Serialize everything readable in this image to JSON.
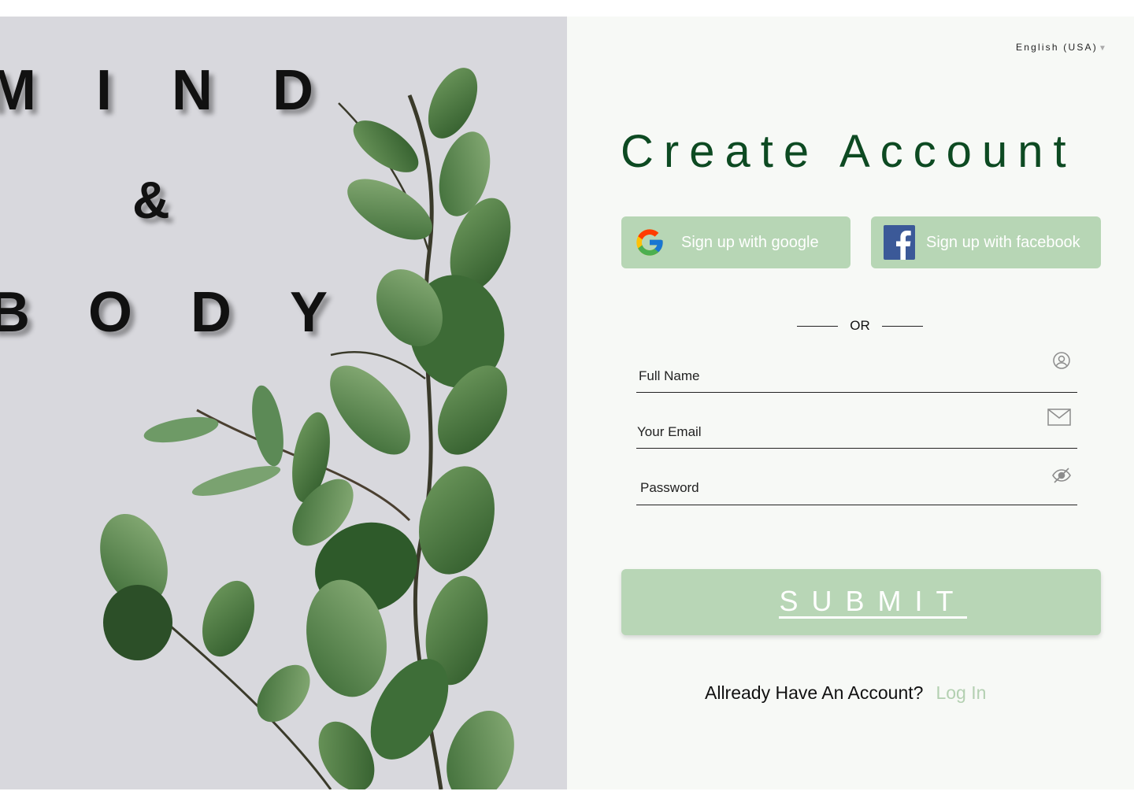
{
  "hero": {
    "word_mind": "MIND",
    "word_amp": "&",
    "word_body": "BODY"
  },
  "language_selector": {
    "label": "English (USA)",
    "caret_icon": "caret-down-icon"
  },
  "form": {
    "title": "Create Account",
    "google_button_label": "Sign up with google",
    "facebook_button_label": "Sign up with facebook",
    "divider_text": "OR",
    "fields": {
      "full_name": {
        "placeholder": "Full Name",
        "value": "",
        "icon": "user-circle-icon"
      },
      "email": {
        "placeholder": "Your Email",
        "value": "",
        "icon": "envelope-icon"
      },
      "password": {
        "placeholder": "Password",
        "value": "",
        "icon": "eye-slash-icon"
      }
    },
    "submit_label": "SUBMIT",
    "login_prompt": "Allready Have An Account?",
    "login_link": "Log In"
  },
  "colors": {
    "accent_green": "#b7d6b5",
    "title_green": "#0d4a22",
    "link_green": "#b3d0b1",
    "panel_background": "#f7f9f6",
    "hero_background": "#d8d8dd"
  }
}
